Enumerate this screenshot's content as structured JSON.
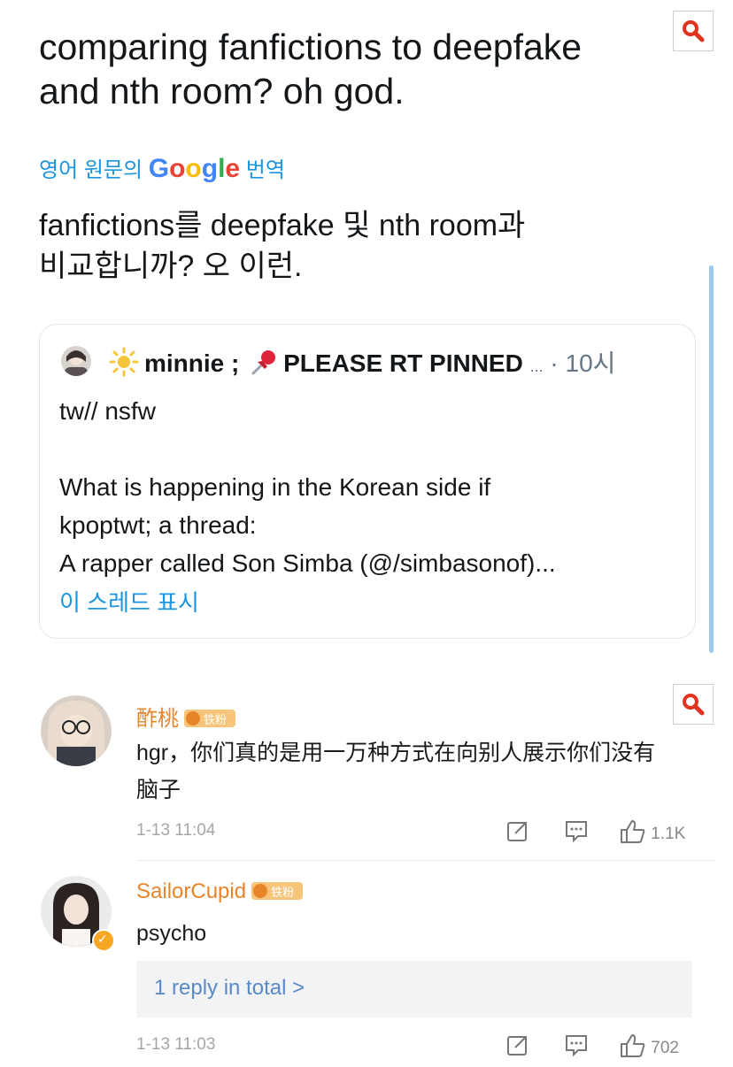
{
  "tweet": {
    "text_line1": "comparing fanfictions to deepfake",
    "text_line2": "and nth room? oh god.",
    "translate_prefix": "영어 원문의",
    "translate_google": [
      "G",
      "o",
      "o",
      "g",
      "l",
      "e"
    ],
    "translate_suffix": "번역",
    "translation_line1": "fanfictions를 deepfake 및 nth room과",
    "translation_line2": "비교합니까? 오 이런."
  },
  "quoted": {
    "name": "minnie ;",
    "pinned_text": "PLEASE RT PINNED",
    "ellipsis": "...",
    "separator": "·",
    "time": "10시",
    "body_line1": "tw// nsfw",
    "body_line2": "What is happening in the Korean side if",
    "body_line3": "kpoptwt; a thread:",
    "body_line4": "A rapper called Son Simba (@/simbasonof)...",
    "show_thread": "이 스레드 표시"
  },
  "comments": [
    {
      "name": "酢桃",
      "badge": "铁粉",
      "text_line1": "hgr，你们真的是用一万种方式在向别人展示你们没有",
      "text_line2": "脑子",
      "time": "1-13 11:04",
      "likes": "1.1K"
    },
    {
      "name": "SailorCupid",
      "badge": "铁粉",
      "text_line1": "psycho",
      "reply_summary": "1 reply in total >",
      "time": "1-13 11:03",
      "likes": "702"
    }
  ],
  "icons": {
    "search": "magnifier-icon",
    "sun": "sun-icon",
    "pin": "pushpin-icon",
    "share": "share-icon",
    "comment": "comment-icon",
    "like": "thumbs-up-icon"
  },
  "colors": {
    "link": "#1b95e0",
    "weibo_name": "#e8842a",
    "search_red": "#e0321f"
  }
}
